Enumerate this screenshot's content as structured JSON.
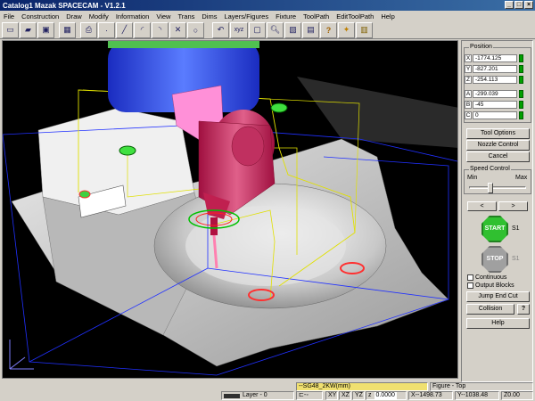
{
  "window": {
    "title": "Catalog1 Mazak SPACECAM - V1.2.1"
  },
  "menu": [
    "File",
    "Construction",
    "Draw",
    "Modify",
    "Information",
    "View",
    "Trans",
    "Dims",
    "Layers/Figures",
    "Fixture",
    "ToolPath",
    "EditToolPath",
    "Help"
  ],
  "toolbar": {
    "xyz_label": "xyz"
  },
  "position": {
    "title": "Position",
    "rows": [
      {
        "axis": "X",
        "value": "-1774.125"
      },
      {
        "axis": "Y",
        "value": "-827.201"
      },
      {
        "axis": "Z",
        "value": "-254.113"
      },
      {
        "axis": "A",
        "value": "-299.039"
      },
      {
        "axis": "B",
        "value": "-45"
      },
      {
        "axis": "C",
        "value": "0"
      }
    ]
  },
  "buttons": {
    "tool_options": "Tool Options",
    "nozzle_control": "Nozzle Control",
    "cancel": "Cancel",
    "jump_end_cut": "Jump End Cut",
    "collision": "Collision",
    "collision_q": "?",
    "help": "Help"
  },
  "speed": {
    "title": "Speed Control",
    "min": "Min",
    "max": "Max",
    "level": 0.35
  },
  "playback": {
    "start": "START",
    "stop": "STOP",
    "s1a": "S1",
    "s1b": "S1",
    "continuous": "Continuous",
    "output_blocks": "Output Blocks"
  },
  "status": {
    "layer": "Layer - 0",
    "tool": "--SG48_2KW(mm)",
    "figure": "Figure - Top",
    "planes": [
      "XY",
      "XZ",
      "YZ"
    ],
    "z_label": "z",
    "z_value": "0.0000",
    "x": "X--1498.73",
    "y": "Y--1038.48",
    "zr": "Z0.00"
  }
}
